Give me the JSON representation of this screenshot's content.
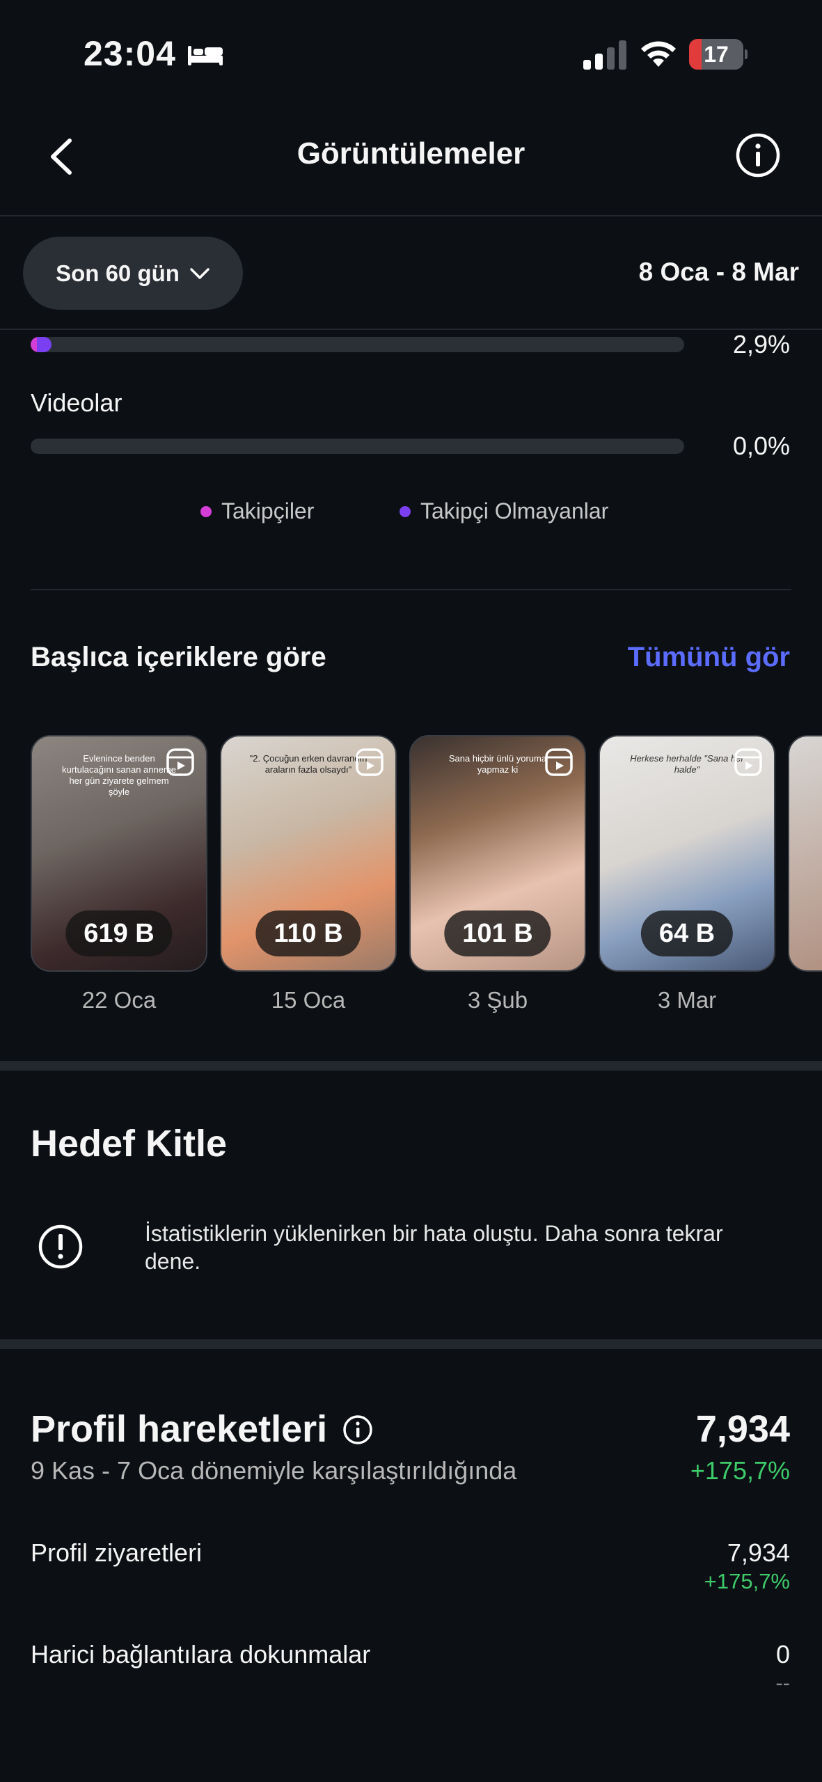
{
  "status": {
    "time": "23:04",
    "battery": "17"
  },
  "header": {
    "title": "Görüntülemeler"
  },
  "filter": {
    "range_label": "Son 60 gün",
    "date_range": "8 Oca - 8 Mar"
  },
  "bars": {
    "first_pct": "2,9%",
    "first_fraction": 0.029,
    "videolar_label": "Videolar",
    "videolar_pct": "0,0%"
  },
  "legend": {
    "followers": "Takipçiler",
    "non_followers": "Takipçi Olmayanlar"
  },
  "colors": {
    "followers": "#d43ed6",
    "non_followers": "#7b3ff2",
    "accent": "#5b6cff",
    "positive": "#3ecb6a"
  },
  "top_content": {
    "title": "Başlıca içeriklere göre",
    "see_all": "Tümünü gör",
    "items": [
      {
        "views": "619 B",
        "date": "22 Oca",
        "caption": "Evlenince benden kurtulacağını sanan anneme her gün ziyarete gelmem şöyle"
      },
      {
        "views": "110 B",
        "date": "15 Oca",
        "caption": "\"2. Çocuğun erken davrandın araların fazla olsaydı\""
      },
      {
        "views": "101 B",
        "date": "3 Şub",
        "caption": "Sana hiçbir ünlü yoruma yapmaz ki"
      },
      {
        "views": "64 B",
        "date": "3 Mar",
        "caption": "Herkese herhalde \"Sana her halde\""
      }
    ]
  },
  "audience": {
    "title": "Hedef Kitle",
    "error": "İstatistiklerin yüklenirken bir hata oluştu. Daha sonra tekrar dene."
  },
  "profile_activity": {
    "title": "Profil hareketleri",
    "subtitle": "9 Kas - 7 Oca dönemiyle karşılaştırıldığında",
    "value": "7,934",
    "change": "+175,7%",
    "rows": [
      {
        "label": "Profil ziyaretleri",
        "value": "7,934",
        "change": "+175,7%"
      },
      {
        "label": "Harici bağlantılara dokunmalar",
        "value": "0",
        "change": "--"
      }
    ]
  }
}
